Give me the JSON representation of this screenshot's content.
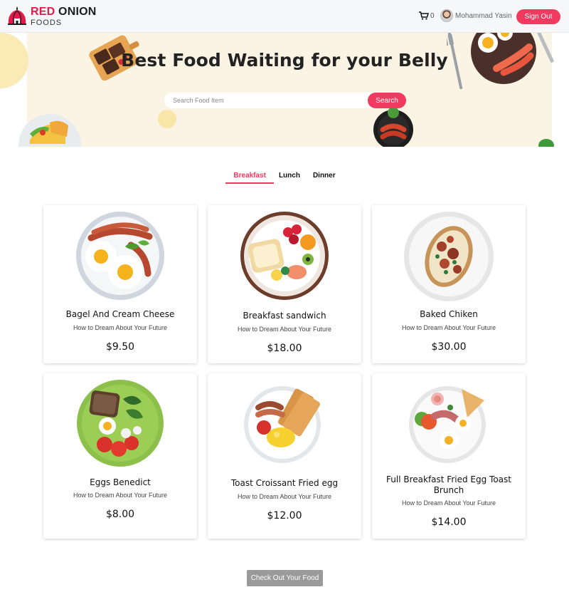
{
  "brand": {
    "name_red": "RED",
    "name_dark": "ONION",
    "sub": "FOODS"
  },
  "nav": {
    "cart_count": "0",
    "user_name": "Mohammad Yasin",
    "signout_label": "Sign Out"
  },
  "hero": {
    "title": "Best Food Waiting for your Belly",
    "search_placeholder": "Search Food Item",
    "search_label": "Search"
  },
  "tabs": [
    {
      "label": "Breakfast",
      "active": true
    },
    {
      "label": "Lunch",
      "active": false
    },
    {
      "label": "Dinner",
      "active": false
    }
  ],
  "foods": [
    {
      "name": "Bagel And Cream Cheese",
      "desc": "How to Dream About Your Future",
      "price": "$9.50",
      "image": "fried-eggs-bacon-plate"
    },
    {
      "name": "Breakfast sandwich",
      "desc": "How to Dream About Your Future",
      "price": "$18.00",
      "image": "bread-fruit-plate"
    },
    {
      "name": "Baked Chiken",
      "desc": "How to Dream About Your Future",
      "price": "$30.00",
      "image": "baked-potato-bacon-plate"
    },
    {
      "name": "Eggs Benedict",
      "desc": "How to Dream About Your Future",
      "price": "$8.00",
      "image": "rye-bread-egg-salad-plate"
    },
    {
      "name": "Toast Croissant Fried egg",
      "desc": "How to Dream About Your Future",
      "price": "$12.00",
      "image": "toast-sausage-scrambled-egg-plate"
    },
    {
      "name": "Full Breakfast Fried Egg Toast Brunch",
      "desc": "How to Dream About Your Future",
      "price": "$14.00",
      "image": "full-english-breakfast-plate"
    }
  ],
  "checkout_label": "Check Out Your Food",
  "colors": {
    "accent": "#f03a5f",
    "hero_bg": "#fbf4e5",
    "checkout_bg": "#9a9a9a"
  }
}
